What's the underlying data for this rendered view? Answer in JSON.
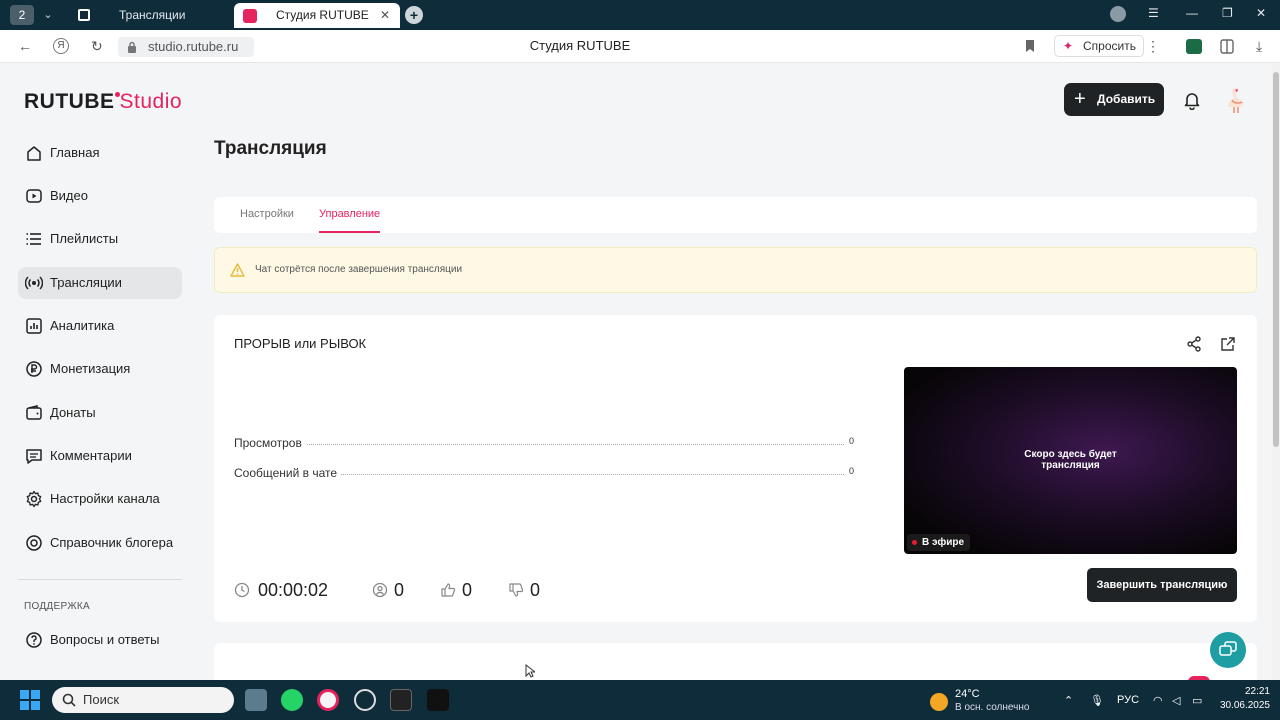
{
  "browser": {
    "tab_count": "2",
    "tab1_title": "Трансляции",
    "tab2_title": "Студия RUTUBE",
    "url": "studio.rutube.ru",
    "page_title": "Студия RUTUBE",
    "ask_label": "Спросить"
  },
  "app": {
    "logo_brand": "RUTUBE",
    "logo_studio": "Studio",
    "add_label": "Добавить",
    "accent_color": "#e5235f"
  },
  "sidebar": {
    "items": [
      {
        "label": "Главная",
        "icon": "home-icon"
      },
      {
        "label": "Видео",
        "icon": "video-icon"
      },
      {
        "label": "Плейлисты",
        "icon": "playlist-icon"
      },
      {
        "label": "Трансляции",
        "icon": "broadcast-icon",
        "active": true
      },
      {
        "label": "Аналитика",
        "icon": "analytics-icon"
      },
      {
        "label": "Монетизация",
        "icon": "monetization-icon"
      },
      {
        "label": "Донаты",
        "icon": "wallet-icon"
      },
      {
        "label": "Комментарии",
        "icon": "comment-icon"
      },
      {
        "label": "Настройки канала",
        "icon": "gear-icon"
      },
      {
        "label": "Справочник блогера",
        "icon": "help-circle-icon"
      }
    ],
    "section_title": "ПОДДЕРЖКА",
    "support_items": [
      {
        "label": "Вопросы и ответы",
        "icon": "question-icon"
      }
    ]
  },
  "main": {
    "title": "Трансляция",
    "tabs": [
      {
        "label": "Настройки"
      },
      {
        "label": "Управление",
        "active": true
      }
    ],
    "warning": "Чат сотрётся после завершения трансляции",
    "stream": {
      "title": "ПРОРЫВ или РЫВОК",
      "stats": [
        {
          "label": "Просмотров",
          "value": "0"
        },
        {
          "label": "Сообщений в чате",
          "value": "0"
        }
      ],
      "preview_text": "Скоро здесь будет трансляция",
      "live_badge": "В эфире",
      "duration": "00:00:02",
      "viewers": "0",
      "likes": "0",
      "dislikes": "0",
      "end_button": "Завершить трансляцию"
    }
  },
  "taskbar": {
    "search_placeholder": "Поиск",
    "temperature": "24°C",
    "weather": "В осн. солнечно",
    "language": "РУС",
    "time": "22:21",
    "date": "30.06.2025"
  }
}
